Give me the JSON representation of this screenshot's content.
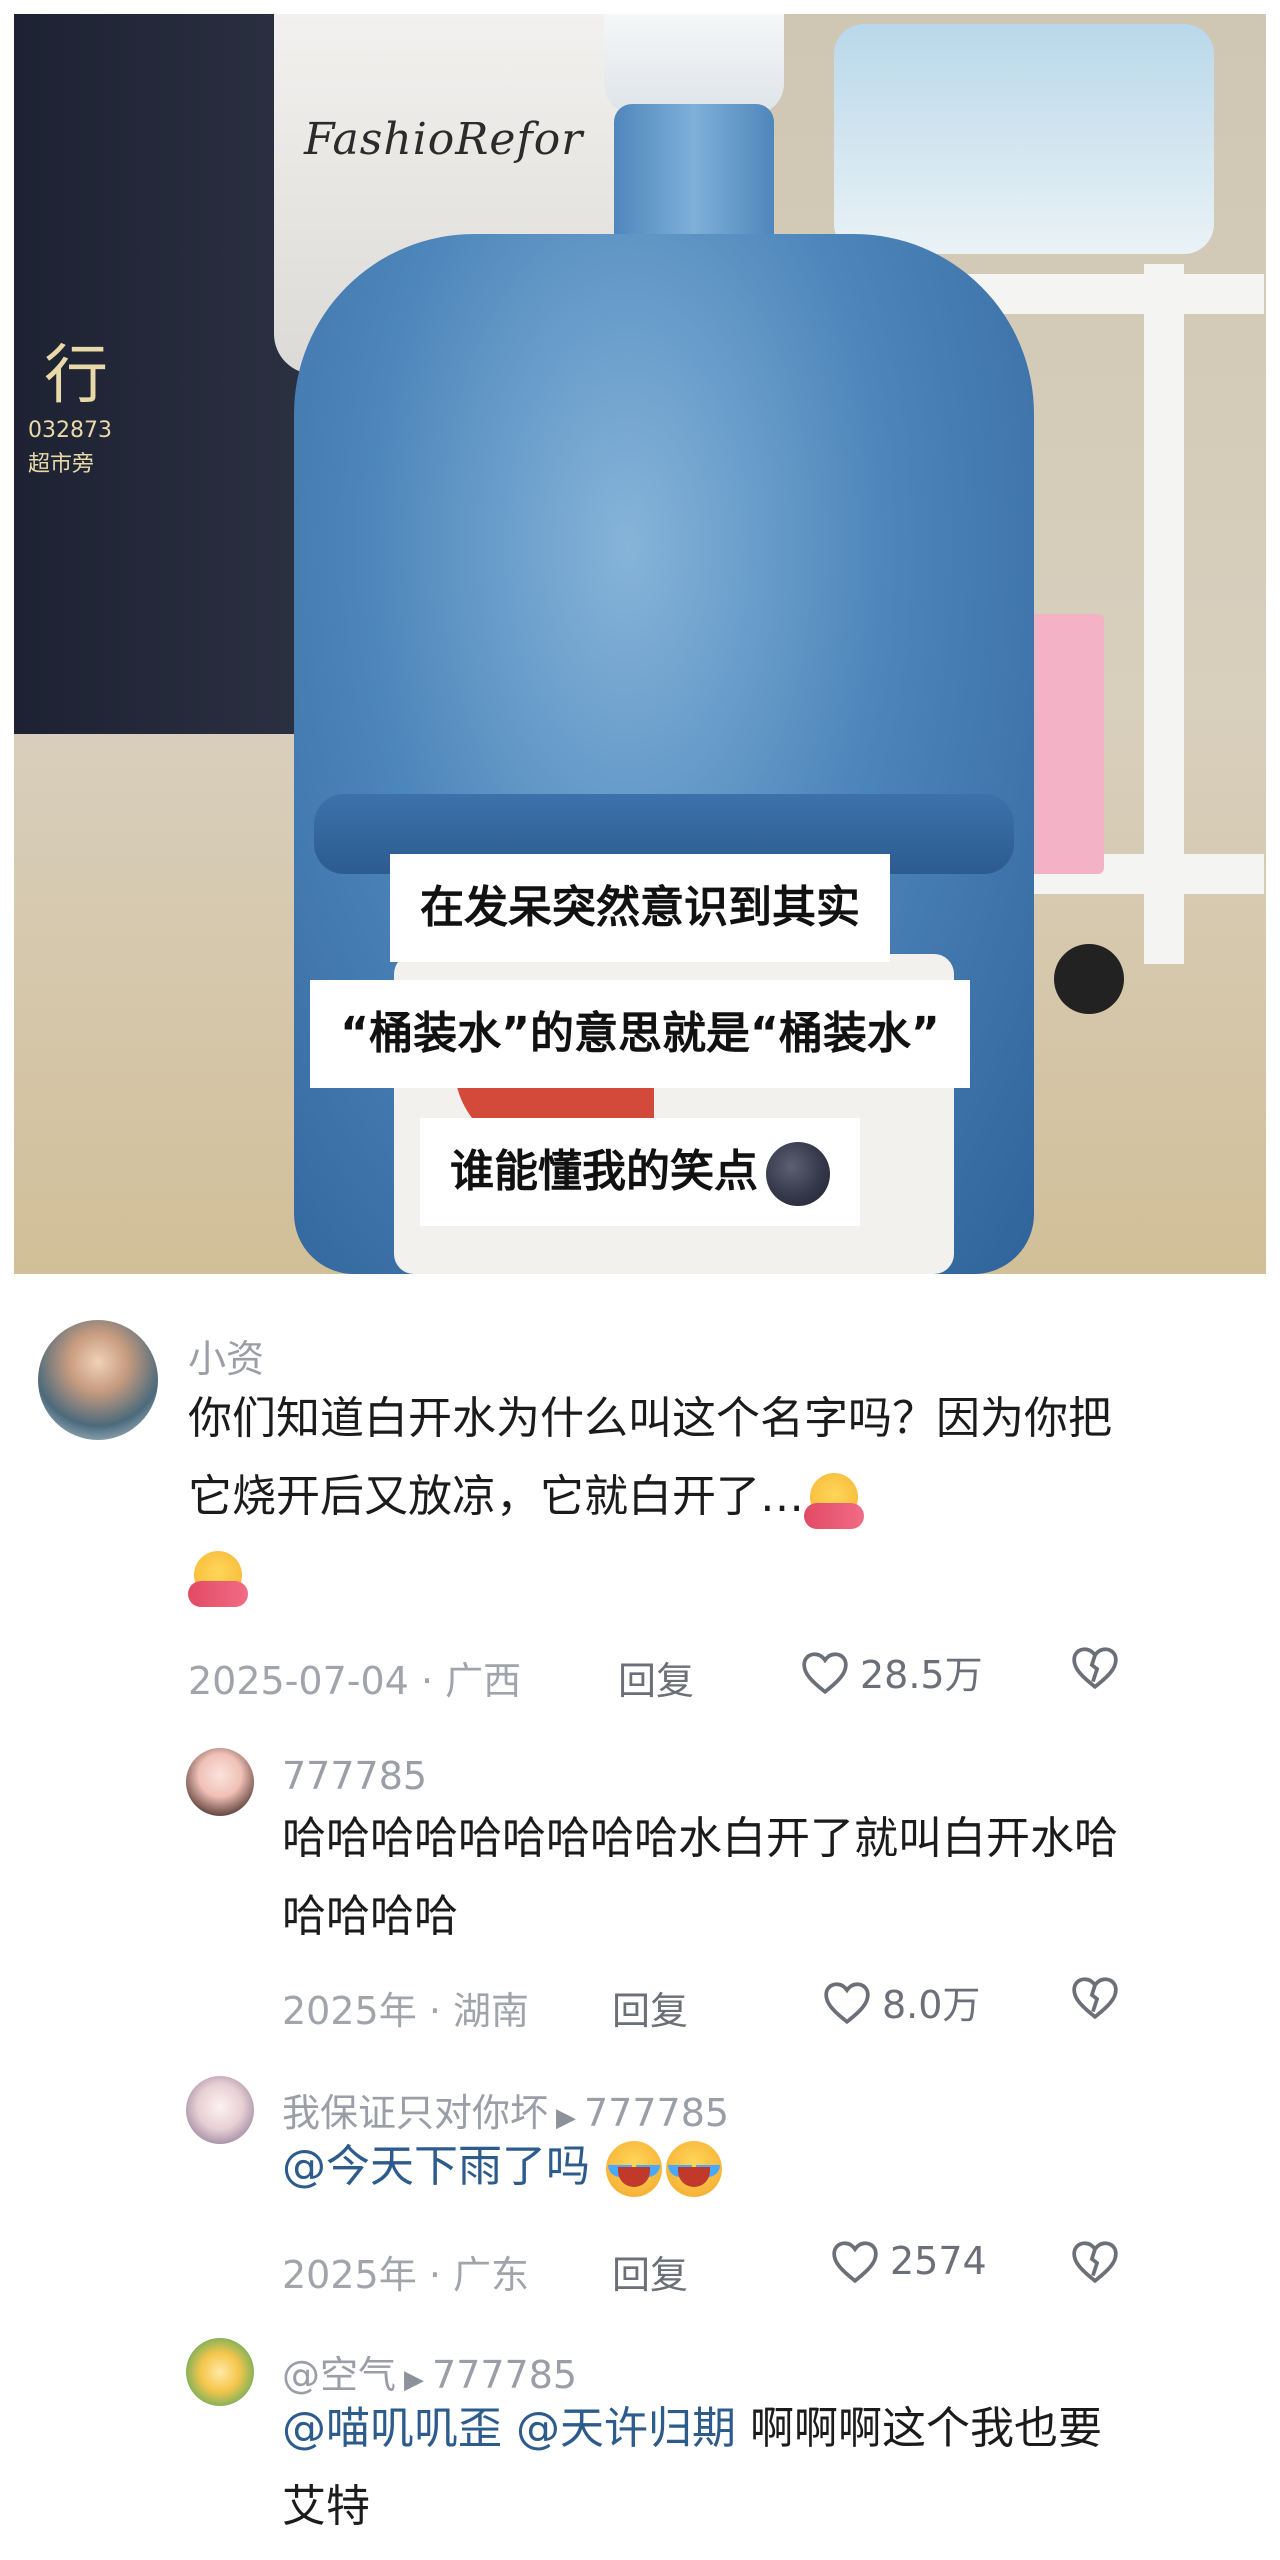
{
  "post": {
    "photo_brand_text": "FashioRefor",
    "left_sign_text": "行",
    "left_sign_sub": "032873\n超市旁",
    "caption_lines": [
      "在发呆突然意识到其实",
      "“桶装水”的意思就是“桶装水”",
      "谁能懂我的笑点"
    ]
  },
  "comments": [
    {
      "username": "小资",
      "text": "你们知道白开水为什么叫这个名字吗？因为你把它烧开后又放凉，它就白开了…",
      "date": "2025-07-04",
      "location": "广西",
      "reply_label": "回复",
      "likes": "28.5万",
      "emoji": "hug-emoji"
    },
    {
      "username": "777785",
      "text": "哈哈哈哈哈哈哈哈哈水白开了就叫白开水哈哈哈哈哈",
      "date": "2025年",
      "location": "湖南",
      "reply_label": "回复",
      "likes": "8.0万"
    },
    {
      "username": "我保证只对你坏",
      "reply_to": "777785",
      "mention": "@今天下雨了吗",
      "date": "2025年",
      "location": "广东",
      "reply_label": "回复",
      "likes": "2574",
      "emoji": "crying-laughing-emoji"
    },
    {
      "username": "@空气",
      "reply_to": "777785",
      "mention1": "@喵叽叽歪",
      "mention2": "@天许归期",
      "text": "啊啊啊这个我也要艾特"
    }
  ],
  "separator": "·",
  "colors": {
    "mention": "#2d5b8c",
    "meta": "#a0a4ab",
    "text": "#1b1b1b"
  }
}
